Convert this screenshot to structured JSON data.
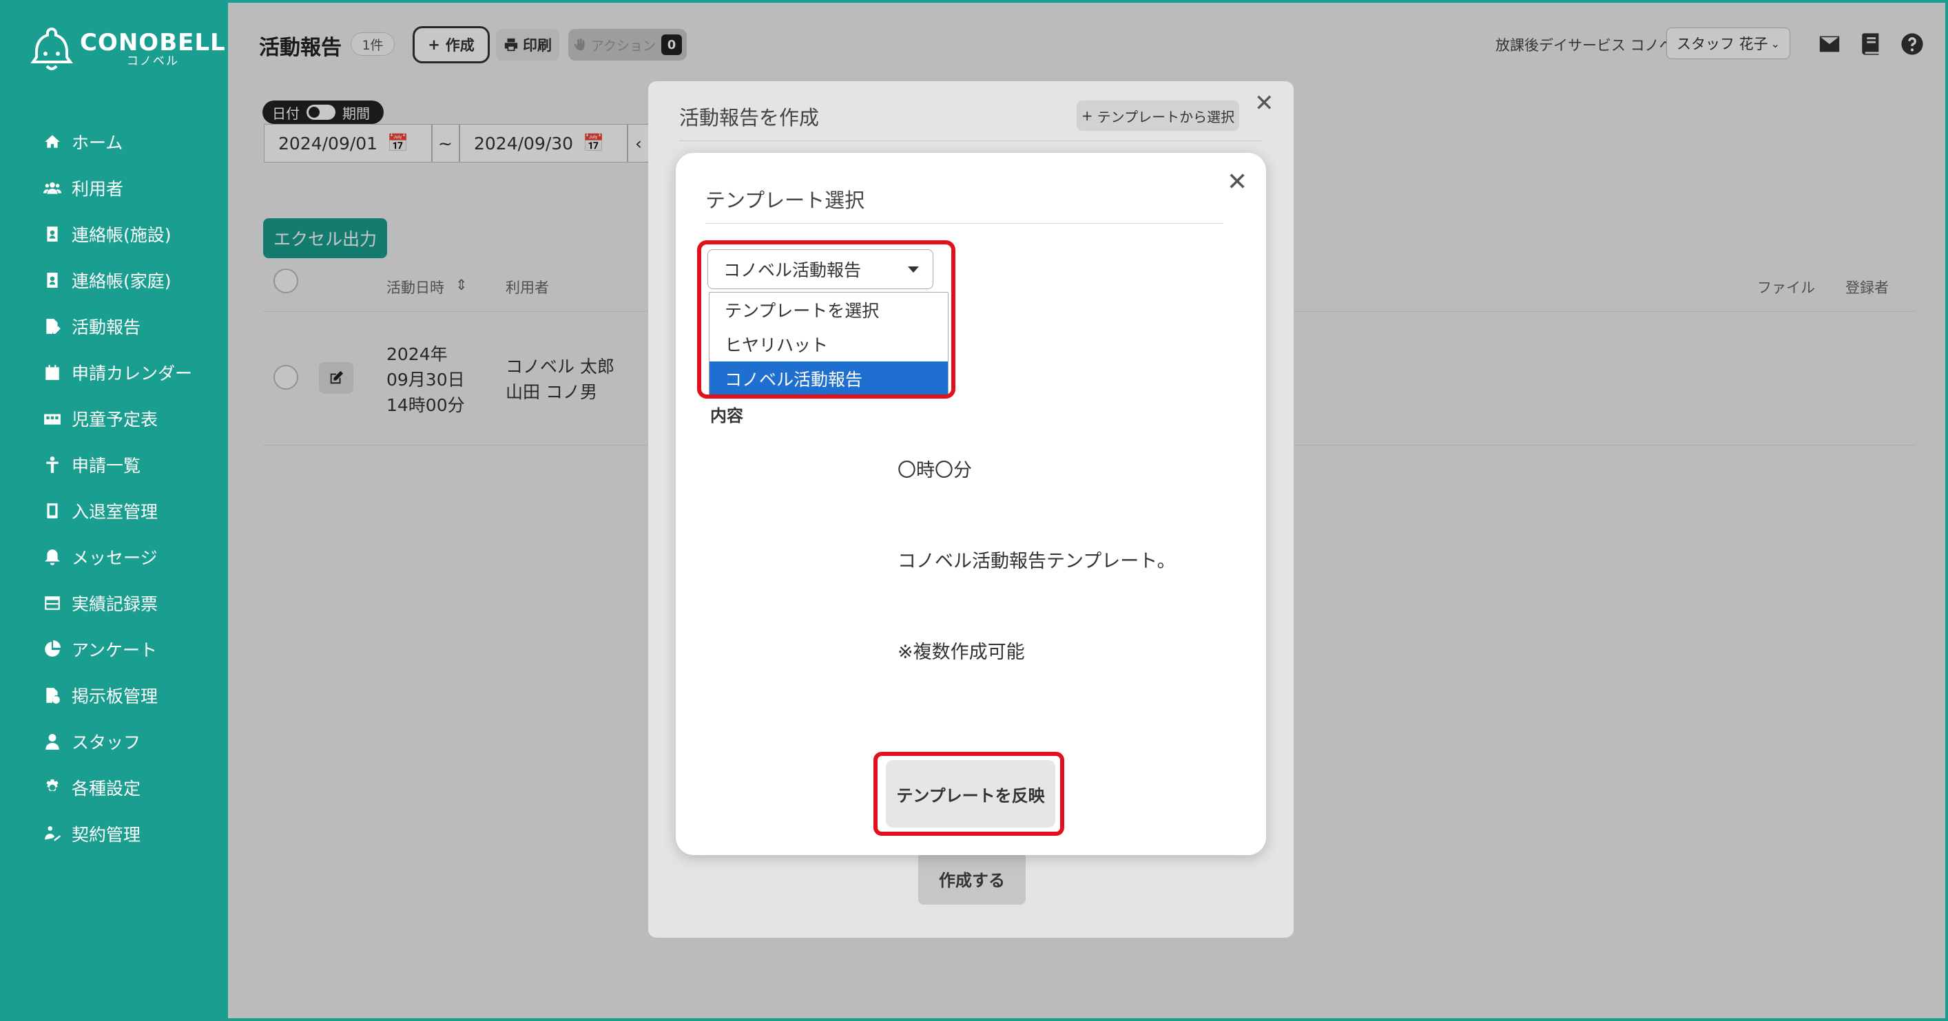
{
  "brand": {
    "name": "CONOBELL",
    "sub": "コノベル"
  },
  "sidebar": {
    "items": [
      {
        "label": "ホーム",
        "icon": "home-icon"
      },
      {
        "label": "利用者",
        "icon": "users-icon"
      },
      {
        "label": "連絡帳(施設)",
        "icon": "contact-book-icon"
      },
      {
        "label": "連絡帳(家庭)",
        "icon": "contact-book-home-icon"
      },
      {
        "label": "活動報告",
        "icon": "activity-report-icon"
      },
      {
        "label": "申請カレンダー",
        "icon": "calendar-icon"
      },
      {
        "label": "児童予定表",
        "icon": "schedule-icon"
      },
      {
        "label": "申請一覧",
        "icon": "child-icon"
      },
      {
        "label": "入退室管理",
        "icon": "tablet-icon"
      },
      {
        "label": "メッセージ",
        "icon": "bell-icon"
      },
      {
        "label": "実績記録票",
        "icon": "table-icon"
      },
      {
        "label": "アンケート",
        "icon": "pie-chart-icon"
      },
      {
        "label": "掲示板管理",
        "icon": "board-icon"
      },
      {
        "label": "スタッフ",
        "icon": "staff-icon"
      },
      {
        "label": "各種設定",
        "icon": "gear-icon"
      },
      {
        "label": "契約管理",
        "icon": "contract-icon"
      }
    ]
  },
  "header": {
    "title": "活動報告",
    "count": "1件",
    "create_label": "作成",
    "print_label": "印刷",
    "action_label": "アクション",
    "action_count": "0",
    "facility": "放課後デイサービス コノベル",
    "staff": "スタッフ 花子"
  },
  "filter": {
    "date_label": "日付",
    "period_label": "期間",
    "from": "2024/09/01",
    "separator": "~",
    "to": "2024/09/30"
  },
  "list": {
    "excel_label": "エクセル出力",
    "columns": [
      "活動日時",
      "利用者",
      "ファイル",
      "登録者"
    ],
    "rows": [
      {
        "date": [
          "2024年",
          "09月30日",
          "14時00分"
        ],
        "users": [
          "コノベル 太郎",
          "山田 コノ男"
        ]
      }
    ]
  },
  "create_modal": {
    "title": "活動報告を作成",
    "template_button": "テンプレートから選択",
    "submit_label": "作成する"
  },
  "template_modal": {
    "title": "テンプレート選択",
    "select_value": "コノベル活動報告",
    "options": [
      "テンプレートを選択",
      "ヒヤリハット",
      "コノベル活動報告"
    ],
    "selected_index": 2,
    "detail_cut": "告",
    "content_label": "内容",
    "content_lines": [
      "〇時〇分",
      "コノベル活動報告テンプレート。",
      "※複数作成可能"
    ],
    "apply_label": "テンプレートを反映"
  },
  "colors": {
    "brand": "#1a9e8f",
    "highlight": "#e0101c",
    "selected": "#1f6fd1"
  }
}
